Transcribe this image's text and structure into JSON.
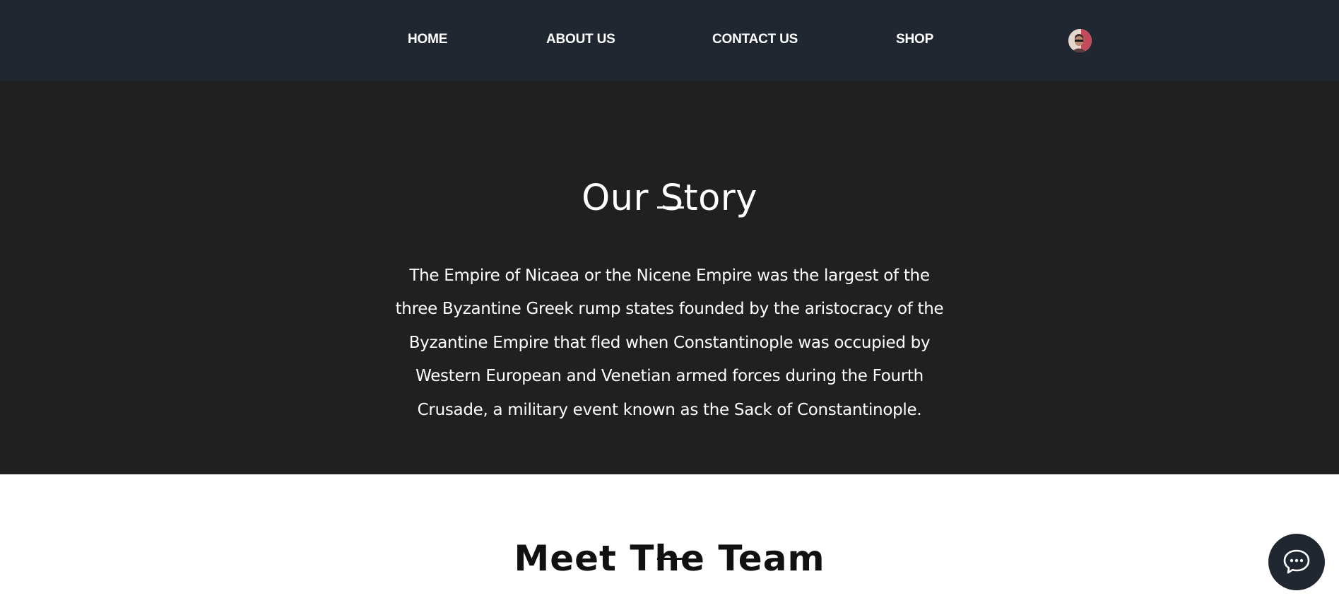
{
  "nav": {
    "items": [
      {
        "label": "HOME"
      },
      {
        "label": "ABOUT US"
      },
      {
        "label": "CONTACT US"
      },
      {
        "label": "SHOP"
      }
    ],
    "avatar_icon": "user-avatar"
  },
  "story": {
    "title": "Our Story",
    "body": "The Empire of Nicaea or the Nicene Empire was the largest of the three Byzantine Greek rump states founded by the aristocracy of the Byzantine Empire that fled when Constantinople was occupied by Western European and Venetian armed forces during the Fourth Crusade, a military event known as the Sack of Constantinople."
  },
  "team": {
    "title": "Meet The Team"
  },
  "chat": {
    "icon": "chat-bubble-icon"
  },
  "colors": {
    "nav_bg": "#202731",
    "story_bg": "#202020",
    "page_bg": "#ffffff",
    "chat_bg": "#202731"
  }
}
